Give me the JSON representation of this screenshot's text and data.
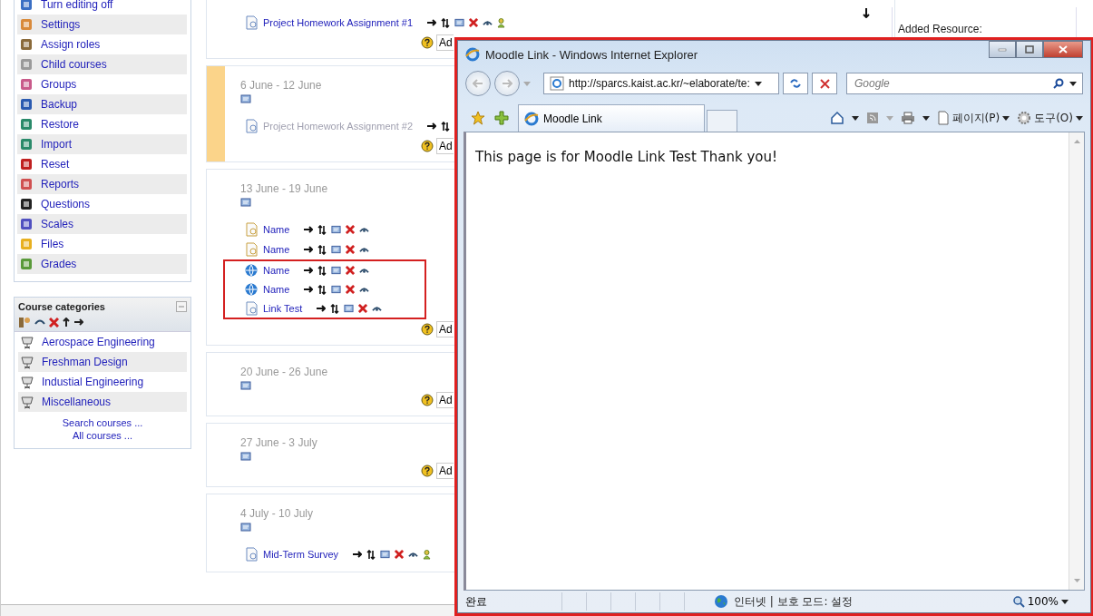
{
  "sidebar": {
    "admin_items": [
      {
        "label": "Turn editing off"
      },
      {
        "label": "Settings"
      },
      {
        "label": "Assign roles"
      },
      {
        "label": "Child courses"
      },
      {
        "label": "Groups"
      },
      {
        "label": "Backup"
      },
      {
        "label": "Restore"
      },
      {
        "label": "Import"
      },
      {
        "label": "Reset"
      },
      {
        "label": "Reports"
      },
      {
        "label": "Questions"
      },
      {
        "label": "Scales"
      },
      {
        "label": "Files"
      },
      {
        "label": "Grades"
      }
    ],
    "categories": {
      "title": "Course categories",
      "items": [
        "Aerospace Engineering",
        "Freshman Design",
        "Industial Engineering",
        "Miscellaneous"
      ],
      "links": [
        "Search courses ...",
        "All courses ..."
      ]
    }
  },
  "sections": [
    {
      "current": false,
      "add_label": "Ad",
      "activities": [
        {
          "title": "Project Homework Assignment #1",
          "kind": "assignment",
          "hidden": false,
          "group_icon": true,
          "marked": false
        }
      ]
    },
    {
      "date": "6 June - 12 June",
      "current": true,
      "add_label": "Ad",
      "activities": [
        {
          "title": "Project Homework Assignment #2",
          "kind": "assignment",
          "hidden": true,
          "group_icon": false,
          "marked": false
        }
      ]
    },
    {
      "date": "13 June - 19 June",
      "current": false,
      "add_label": "Ad",
      "activities": [
        {
          "title": "Name",
          "kind": "resource",
          "hidden": false,
          "group_icon": false,
          "marked": false
        },
        {
          "title": "Name",
          "kind": "resource",
          "hidden": false,
          "group_icon": false,
          "marked": false
        },
        {
          "title": "Name",
          "kind": "link",
          "hidden": false,
          "group_icon": false,
          "marked": true
        },
        {
          "title": "Name",
          "kind": "link",
          "hidden": false,
          "group_icon": false,
          "marked": true
        },
        {
          "title": "Link Test",
          "kind": "page",
          "hidden": false,
          "group_icon": false,
          "marked": true
        }
      ]
    },
    {
      "date": "20 June - 26 June",
      "current": false,
      "add_label": "Ad"
    },
    {
      "date": "27 June - 3 July",
      "current": false,
      "add_label": "Ad"
    },
    {
      "date": "4 July - 10 July",
      "current": false,
      "activities": [
        {
          "title": "Mid-Term Survey",
          "kind": "survey",
          "hidden": false,
          "group_icon": true,
          "marked": false
        }
      ]
    }
  ],
  "right_block": {
    "text": "Added Resource:"
  },
  "browser": {
    "title": "Moodle Link - Windows Internet Explorer",
    "address": "http://sparcs.kaist.ac.kr/~elaborate/te:",
    "search_placeholder": "Google",
    "tab": "Moodle Link",
    "toolbar": [
      "페이지(P)",
      "도구(O)"
    ],
    "content": "This page is for Moodle Link Test Thank you!",
    "status": "완료",
    "zone": "인터넷 | 보호 모드: 설정",
    "zoom": "100%"
  }
}
